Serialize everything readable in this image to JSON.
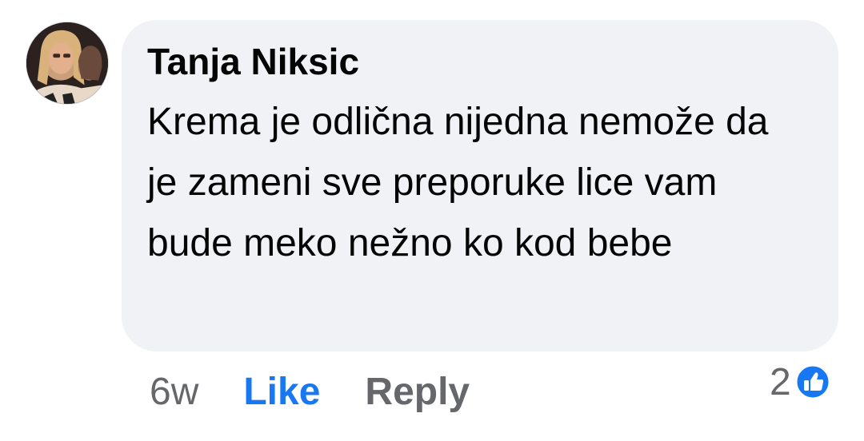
{
  "comment": {
    "author": "Tanja Niksic",
    "text": "Krema je odlična nijedna nemože da je zameni sve preporuke lice vam bude meko nežno ko kod bebe",
    "avatar_icon": "user-avatar-photo"
  },
  "actions": {
    "timestamp": "6w",
    "like_label": "Like",
    "reply_label": "Reply"
  },
  "reactions": {
    "count": "2",
    "icon": "like-reaction-icon"
  },
  "colors": {
    "bubble_bg": "#f0f2f5",
    "text": "#050505",
    "secondary_text": "#65676b",
    "like_blue": "#1877f2"
  }
}
